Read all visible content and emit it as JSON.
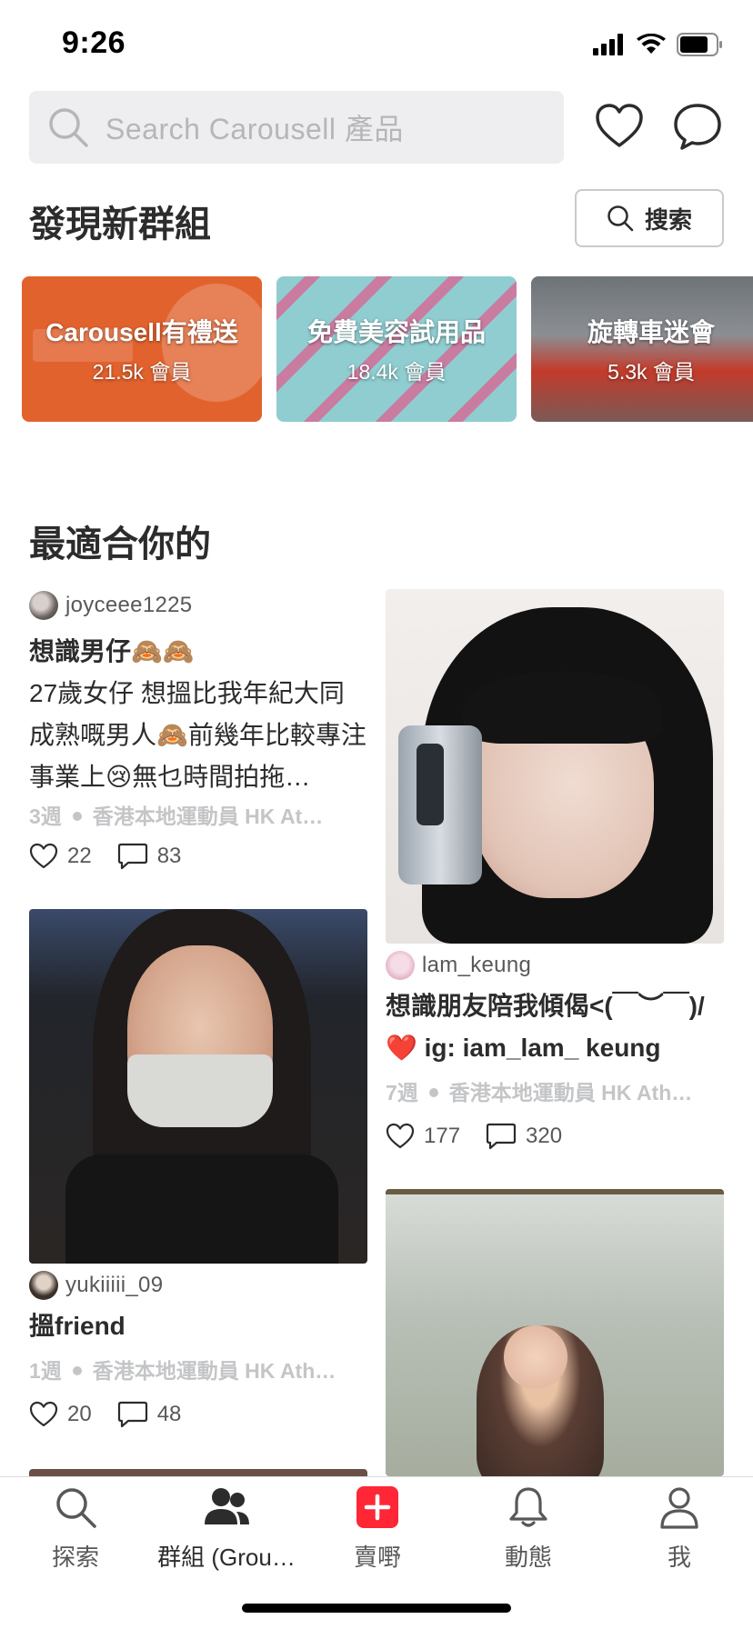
{
  "status": {
    "time": "9:26"
  },
  "header": {
    "search_placeholder": "Search Carousell 產品"
  },
  "discover": {
    "title": "發現新群組",
    "search_label": "搜索",
    "groups": [
      {
        "name": "Carousell有禮送",
        "count": "21.5k 會員"
      },
      {
        "name": "免費美容試用品",
        "count": "18.4k 會員"
      },
      {
        "name": "旋轉車迷會",
        "count": "5.3k 會員"
      }
    ]
  },
  "feed": {
    "title": "最適合你的",
    "posts": [
      {
        "username": "joyceee1225",
        "title": "想識男仔🙈🙈",
        "body": "27歲女仔 想搵比我年紀大同成熟嘅男人🙈前幾年比較專注事業上😢無乜時間拍拖…",
        "age": "3週",
        "group": "香港本地運動員 HK At…",
        "likes": "22",
        "comments": "83"
      },
      {
        "username": "lam_keung",
        "title": "想識朋友陪我傾偈<(￣︶￣)/❤️ ig: iam_lam_ keung",
        "age": "7週",
        "group": "香港本地運動員 HK Ath…",
        "likes": "177",
        "comments": "320"
      },
      {
        "username": "yukiiiii_09",
        "title": "搵friend",
        "age": "1週",
        "group": "香港本地運動員 HK Ath…",
        "likes": "20",
        "comments": "48"
      }
    ]
  },
  "tabs": [
    {
      "label": "探索",
      "icon": "search-icon"
    },
    {
      "label": "群組 (Grou…",
      "icon": "groups-icon"
    },
    {
      "label": "賣嘢",
      "icon": "sell-plus-icon"
    },
    {
      "label": "動態",
      "icon": "bell-icon"
    },
    {
      "label": "我",
      "icon": "profile-icon"
    }
  ],
  "colors": {
    "accent": "#ff2636",
    "text": "#2c2c2d",
    "muted": "#c4c5c7"
  }
}
